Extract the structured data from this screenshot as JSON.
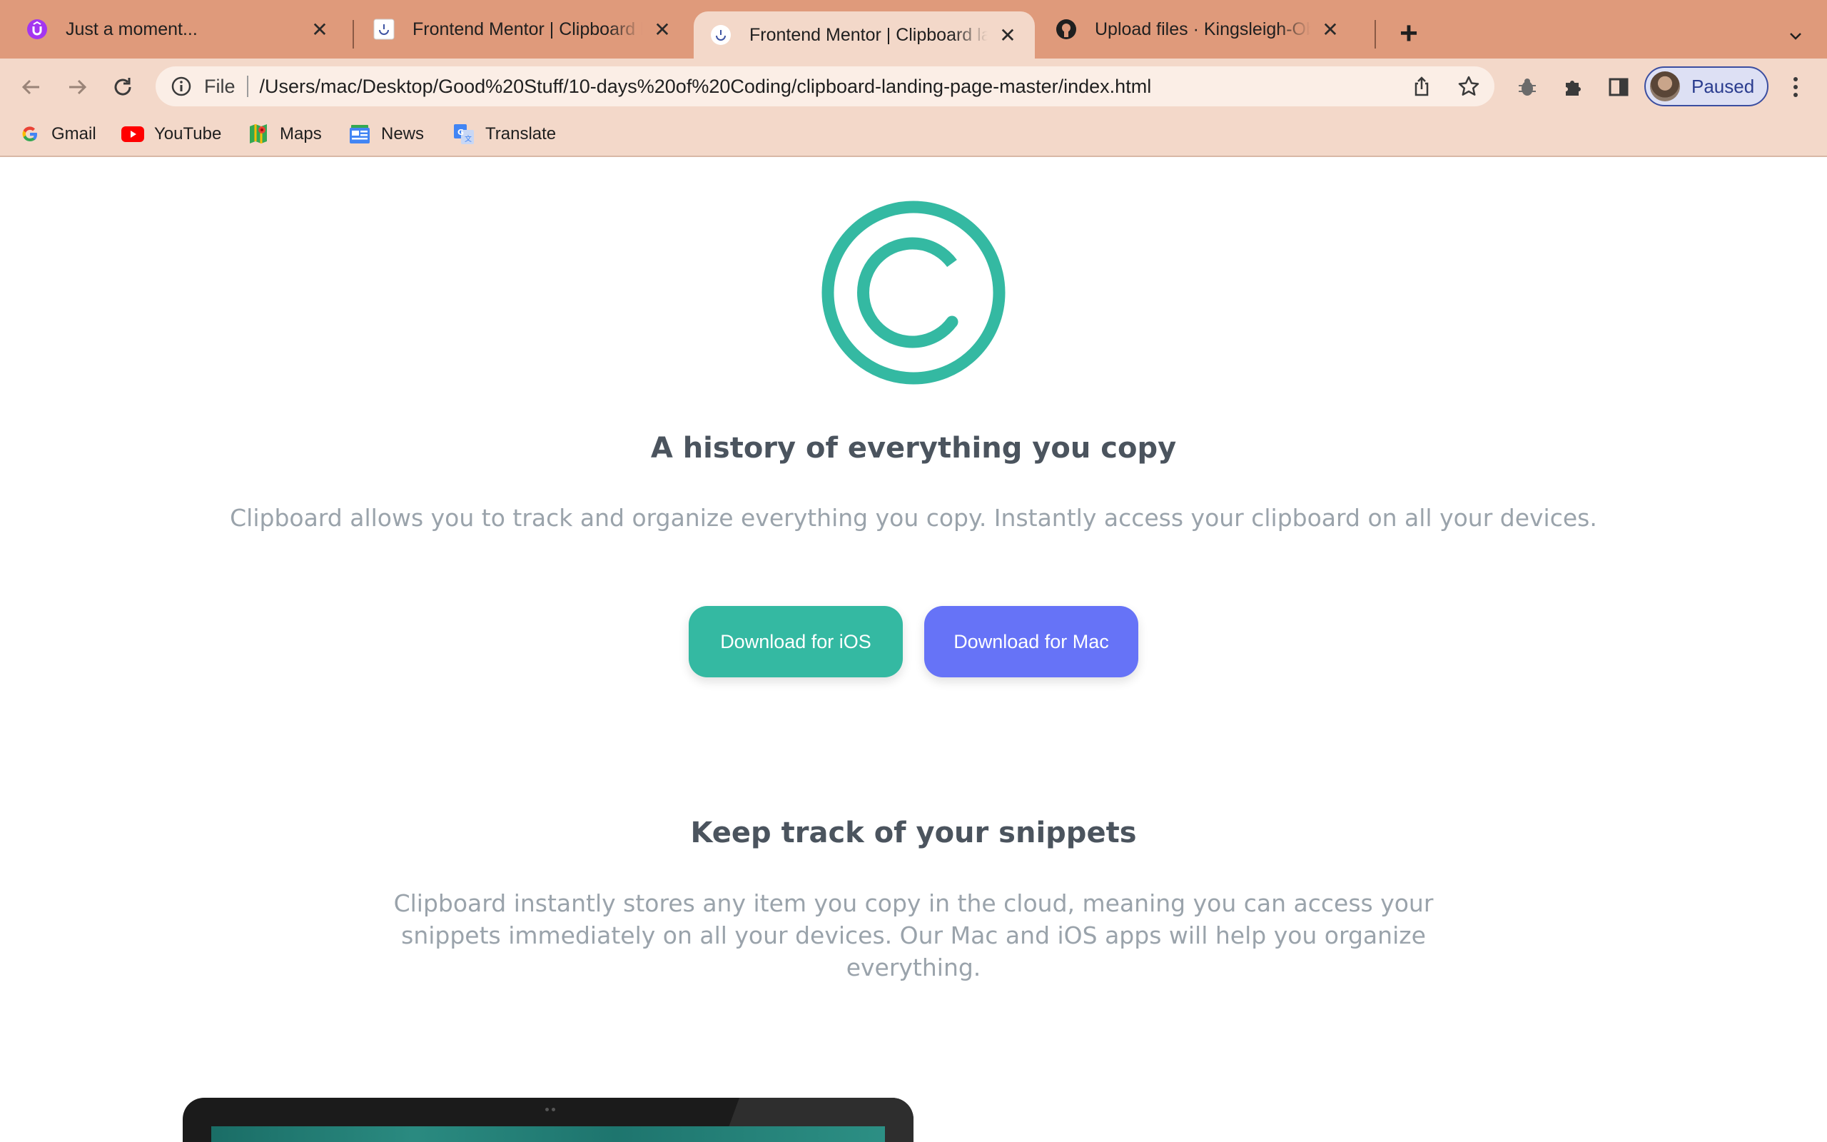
{
  "browser": {
    "tabs": [
      {
        "title": "Just a moment...",
        "favicon": "udemy-icon",
        "active": false
      },
      {
        "title": "Frontend Mentor | Clipboard landing page",
        "favicon": "frontend-mentor-icon",
        "active": false
      },
      {
        "title": "Frontend Mentor | Clipboard landing page",
        "favicon": "frontend-mentor-icon",
        "active": true
      },
      {
        "title": "Upload files · Kingsleigh-Obi/clipboard",
        "favicon": "github-icon",
        "active": false
      }
    ],
    "address": {
      "scheme_label": "File",
      "url": "/Users/mac/Desktop/Good%20Stuff/10-days%20of%20Coding/clipboard-landing-page-master/index.html"
    },
    "profile_label": "Paused",
    "bookmarks": [
      {
        "label": "Gmail",
        "icon": "google-icon"
      },
      {
        "label": "YouTube",
        "icon": "youtube-icon"
      },
      {
        "label": "Maps",
        "icon": "maps-icon"
      },
      {
        "label": "News",
        "icon": "news-icon"
      },
      {
        "label": "Translate",
        "icon": "translate-icon"
      }
    ]
  },
  "page": {
    "hero_title": "A history of everything you copy",
    "hero_text": "Clipboard allows you to track and organize everything you copy. Instantly access your clipboard on all your devices.",
    "btn_ios": "Download for iOS",
    "btn_mac": "Download for Mac",
    "snippets_title": "Keep track of your snippets",
    "snippets_text": "Clipboard instantly stores any item you copy in the cloud, meaning you can access your snippets immediately on all your devices. Our Mac and iOS apps will help you organize everything."
  },
  "colors": {
    "tabstrip": "#df9a7b",
    "toolbar": "#f3d8c9",
    "brand_green": "#34b9a2",
    "brand_blue": "#6673f7",
    "heading": "#4b545e",
    "body_text": "#9aa3ab"
  }
}
